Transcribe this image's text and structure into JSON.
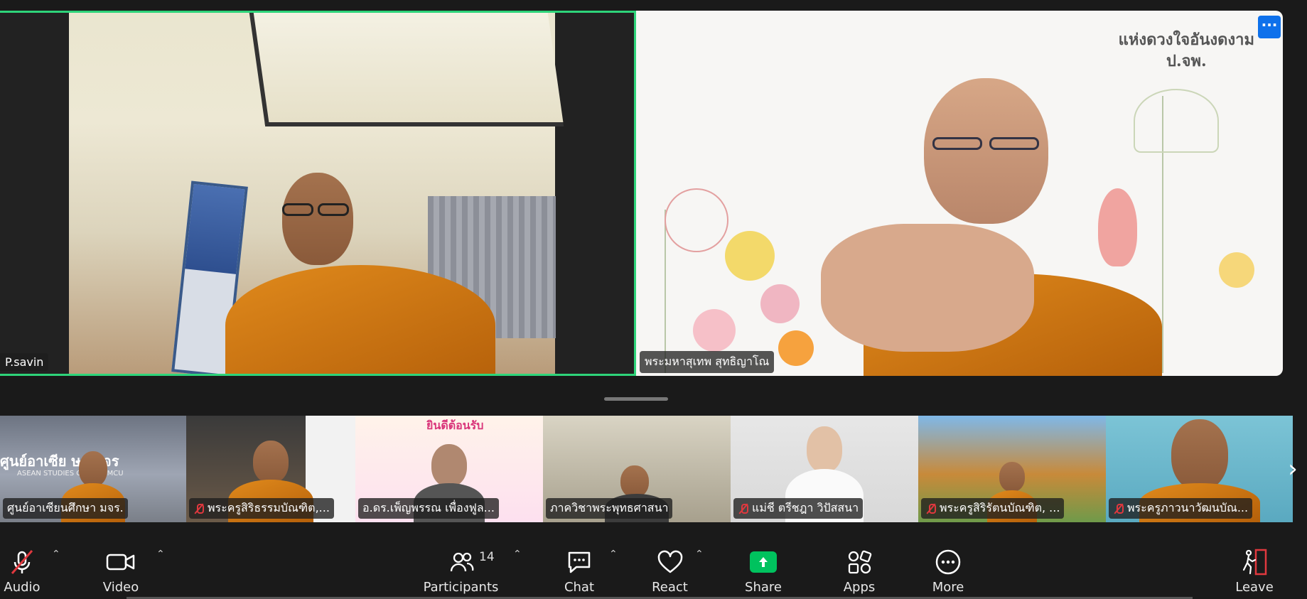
{
  "main_tiles": {
    "left": {
      "name": "P.savin"
    },
    "right": {
      "name": "พระมหาสุเทพ สุทธิญาโณ",
      "background_text_line1": "แห่งดวงใจอันงดงาม",
      "background_text_line2": "ป.จพ.",
      "more_icon": "more-horizontal-icon"
    }
  },
  "thumbnails": [
    {
      "name": "ศูนย์อาเซียนศึกษา มจร.",
      "muted": false,
      "bg_text": "ศูนย์อาเซีย ษา มจร",
      "bg_text2": "ASEAN STUDIES CENTER MCU"
    },
    {
      "name": "พระครูสิริธรรมบัณฑิต,...",
      "muted": true
    },
    {
      "name": "อ.ดร.เพ็ญพรรณ เพื่องฟูล...",
      "muted": false,
      "bg_text": "ยินดีต้อนรับ"
    },
    {
      "name": "ภาควิชาพระพุทธศาสนา",
      "muted": false
    },
    {
      "name": "แม่ชี ตรีชฎา วิปัสสนา",
      "muted": true
    },
    {
      "name": "พระครูสิริรัตนบัณฑิต, ...",
      "muted": true
    },
    {
      "name": "พระครูภาวนาวัฒนบัณ...",
      "muted": true
    }
  ],
  "toolbar": {
    "audio_label": "Audio",
    "video_label": "Video",
    "participants_label": "Participants",
    "participants_count": "14",
    "chat_label": "Chat",
    "react_label": "React",
    "share_label": "Share",
    "apps_label": "Apps",
    "more_label": "More",
    "leave_label": "Leave"
  },
  "colors": {
    "active_speaker_border": "#2ed47a",
    "share_green": "#00c25e",
    "mute_red": "#e0383e",
    "more_button_blue": "#0e71eb"
  }
}
